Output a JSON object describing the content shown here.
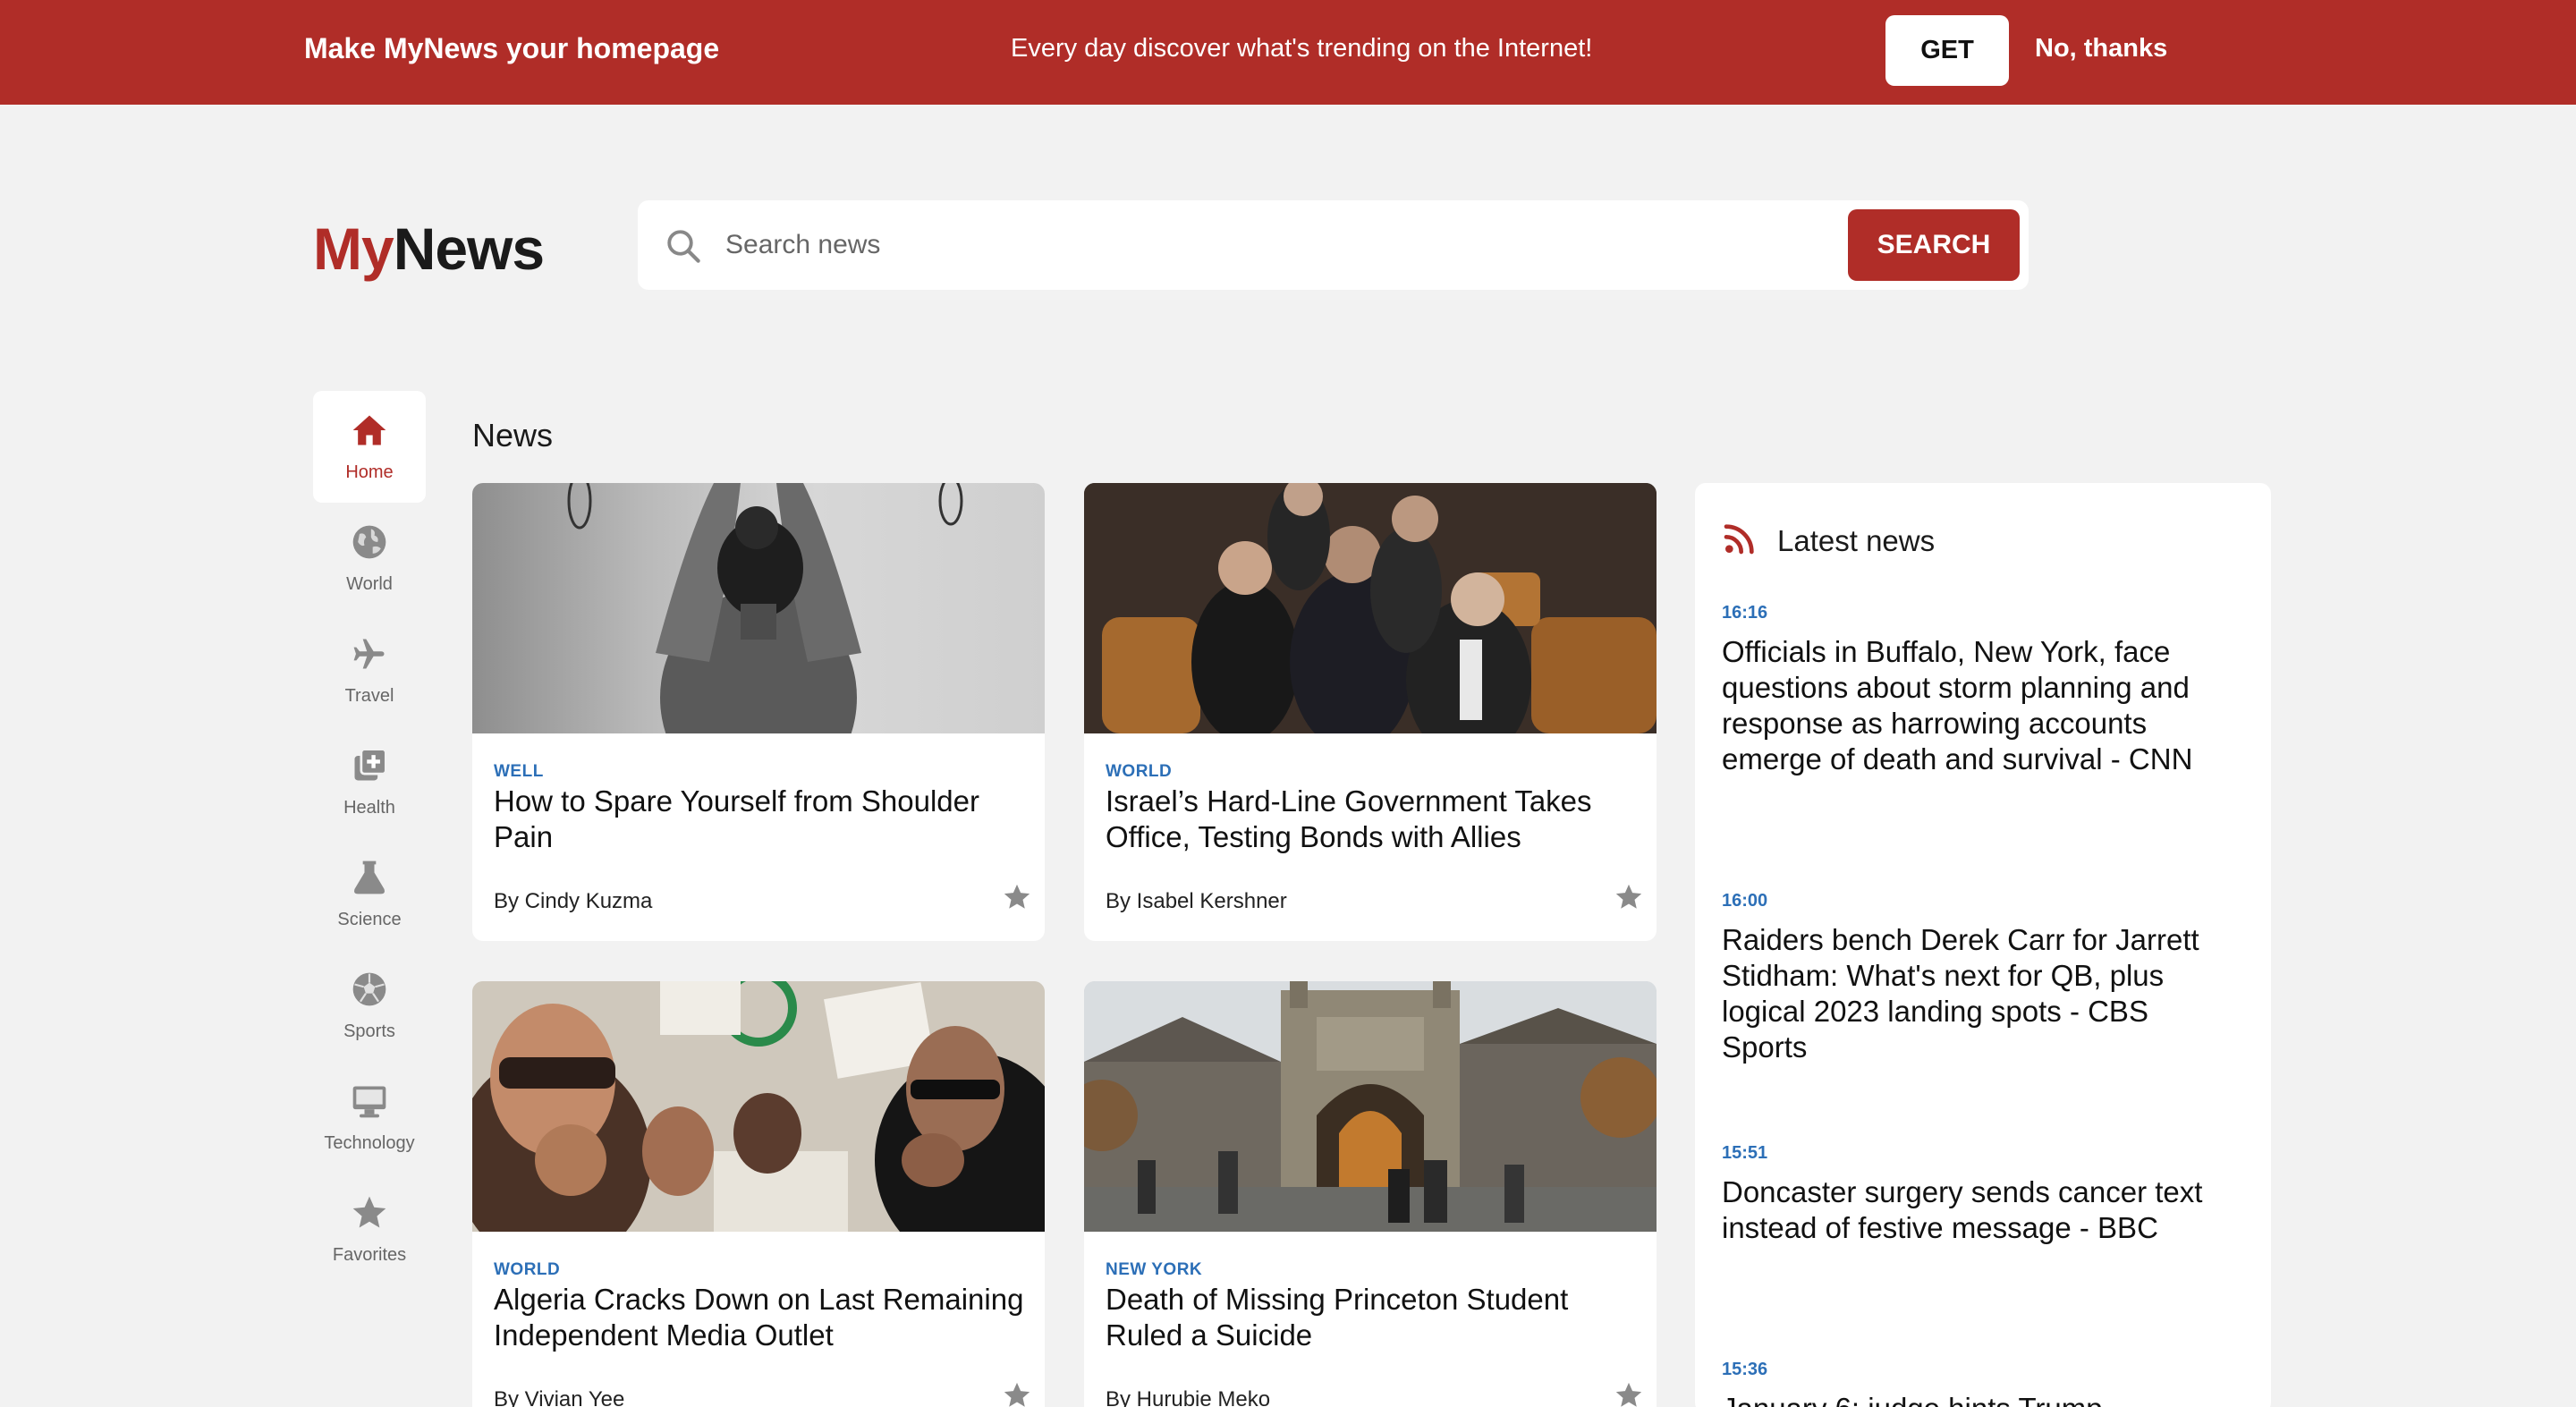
{
  "promo": {
    "headline": "Make MyNews your homepage",
    "tagline": "Every day discover what's trending on the Internet!",
    "get_label": "GET",
    "dismiss_label": "No, thanks"
  },
  "brand": {
    "my": "My",
    "news": "News",
    "accent": "#b02d28"
  },
  "search": {
    "placeholder": "Search news",
    "value": "",
    "button_label": "SEARCH"
  },
  "nav": {
    "items": [
      {
        "label": "Home",
        "icon": "home-icon",
        "active": true
      },
      {
        "label": "World",
        "icon": "globe-icon"
      },
      {
        "label": "Travel",
        "icon": "airplane-icon"
      },
      {
        "label": "Health",
        "icon": "medical-icon"
      },
      {
        "label": "Science",
        "icon": "flask-icon"
      },
      {
        "label": "Sports",
        "icon": "soccer-ball-icon"
      },
      {
        "label": "Technology",
        "icon": "monitor-icon"
      },
      {
        "label": "Favorites",
        "icon": "star-icon"
      }
    ]
  },
  "main": {
    "section_title": "News",
    "cards": [
      {
        "category": "WELL",
        "title": "How to Spare Yourself from Shoulder Pain",
        "author": "By Cindy Kuzma"
      },
      {
        "category": "WORLD",
        "title": "Israel’s Hard-Line Government Takes Office, Testing Bonds with Allies",
        "author": "By Isabel Kershner"
      },
      {
        "category": "WORLD",
        "title": "Algeria Cracks Down on Last Remaining Independent Media Outlet",
        "author": "By Vivian Yee"
      },
      {
        "category": "NEW YORK",
        "title": "Death of Missing Princeton Student Ruled a Suicide",
        "author": "By Hurubie Meko"
      }
    ]
  },
  "latest": {
    "title": "Latest news",
    "items": [
      {
        "time": "16:16",
        "headline": "Officials in Buffalo, New York, face questions about storm planning and response as harrowing accounts emerge of death and survival - CNN"
      },
      {
        "time": "16:00",
        "headline": "Raiders bench Derek Carr for Jarrett Stidham: What's next for QB, plus logical 2023 landing spots - CBS Sports"
      },
      {
        "time": "15:51",
        "headline": "Doncaster surgery sends cancer text instead of festive message - BBC"
      },
      {
        "time": "15:36",
        "headline": "January 6: judge hints Trump"
      }
    ]
  }
}
